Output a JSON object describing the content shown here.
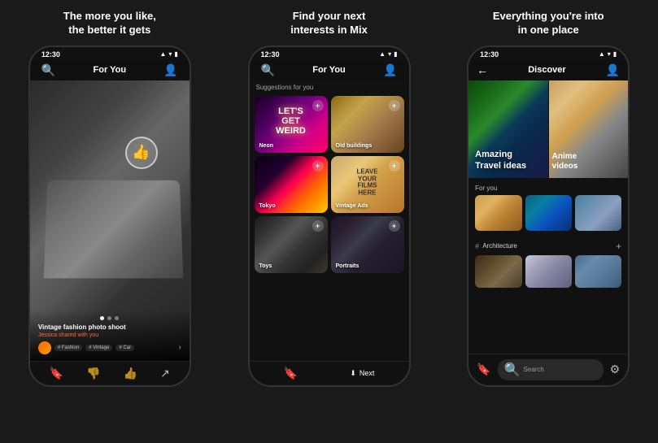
{
  "background_color": "#1a1a1a",
  "panels": [
    {
      "title": "The more you like,\nthe better it gets",
      "phone": {
        "status_time": "12:30",
        "nav_title": "For You",
        "caption_title": "Vintage fashion photo shoot",
        "caption_sub": "Jessica shared with you",
        "tags": [
          "# Fashion",
          "# Vintage",
          "# Car"
        ],
        "like_icon": "👍",
        "toolbar_icons": [
          "🔖",
          "👎",
          "👍",
          "↗"
        ]
      }
    },
    {
      "title": "Find your next\ninterests in Mix",
      "phone": {
        "status_time": "12:30",
        "nav_title": "For You",
        "suggestions_label": "Suggestions for you",
        "grid_items": [
          {
            "label": "Neon",
            "type": "neon",
            "neon_text": "LET'S\nGET\nWEIRD"
          },
          {
            "label": "Old buildings",
            "type": "old-buildings"
          },
          {
            "label": "Tokyo",
            "type": "tokyo"
          },
          {
            "label": "Vintage Ads",
            "type": "vintage",
            "vintage_text": "LEAVE\nYOUR\nFILMS\nHERE"
          },
          {
            "label": "Toys",
            "type": "toys"
          },
          {
            "label": "Portraits",
            "type": "portraits"
          }
        ],
        "next_btn": "Next"
      }
    },
    {
      "title": "Everything you're into\nin one place",
      "phone": {
        "status_time": "12:30",
        "nav_title": "Discover",
        "hero_items": [
          {
            "label": "Amazing\nTravel ideas",
            "type": "travel"
          },
          {
            "label": "Anime\nvideos",
            "type": "anime"
          }
        ],
        "for_you_label": "For you",
        "architecture_label": "Architecture",
        "search_placeholder": "Search"
      }
    }
  ]
}
